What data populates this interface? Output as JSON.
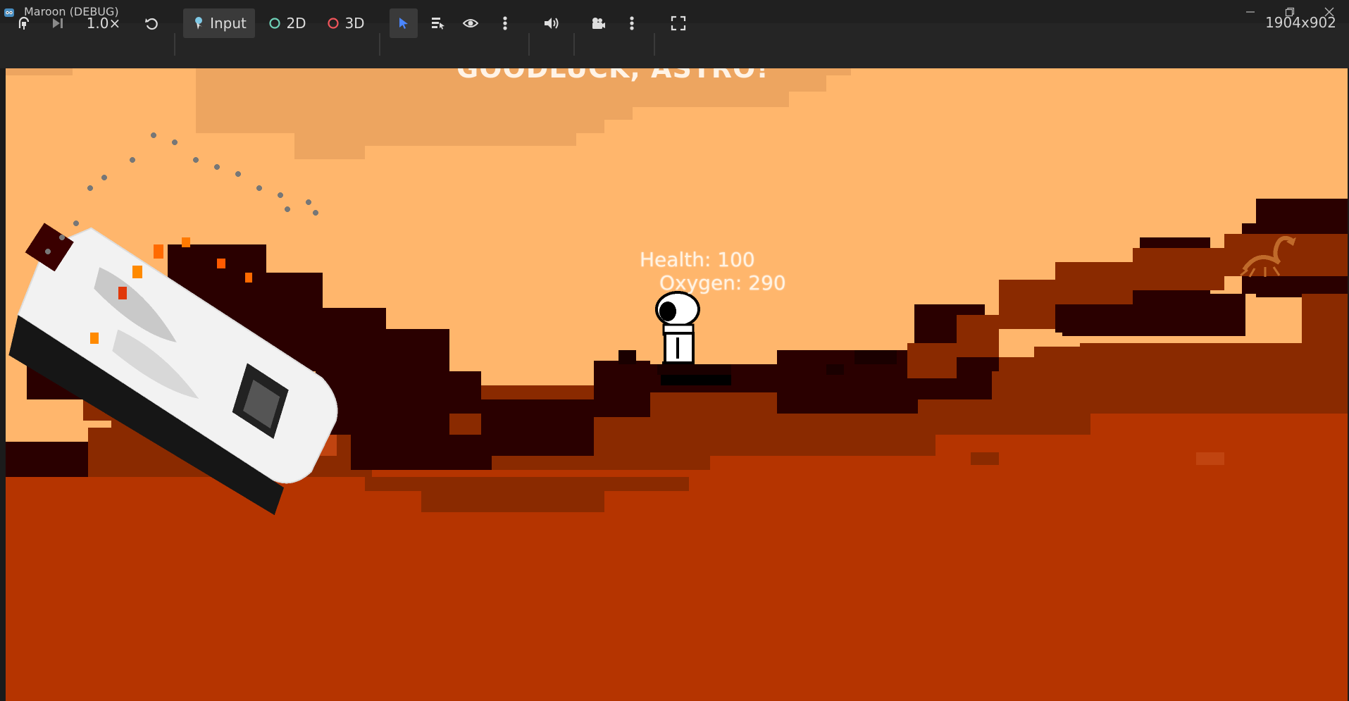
{
  "window": {
    "title": "Maroon (DEBUG)"
  },
  "toolbar": {
    "speed_label": "1.0×",
    "input_label": "Input",
    "mode_2d_label": "2D",
    "mode_3d_label": "3D",
    "resolution": "1904x902"
  },
  "game": {
    "banner": "GOODLUCK, ASTRO!",
    "health_label": "Health: 100",
    "oxygen_label": "Oxygen: 290",
    "health": 100,
    "oxygen": 290
  },
  "colors": {
    "sky": "#ffb66c",
    "cloud": "#eda560",
    "rock_dark": "#2a0000",
    "rock_mid": "#8a2a00",
    "rock_ground": "#b53400",
    "accent_select": "#4a86ff"
  },
  "icons": [
    "godot-logo-icon",
    "remote-debug-icon",
    "step-frame-icon",
    "reset-speed-icon",
    "input-icon",
    "circle-2d-icon",
    "circle-3d-icon",
    "select-arrow-icon",
    "list-select-icon",
    "eye-icon",
    "more-vertical-icon",
    "audio-icon",
    "camera-icon",
    "fullscreen-icon",
    "minimize-icon",
    "restore-icon",
    "close-icon"
  ]
}
